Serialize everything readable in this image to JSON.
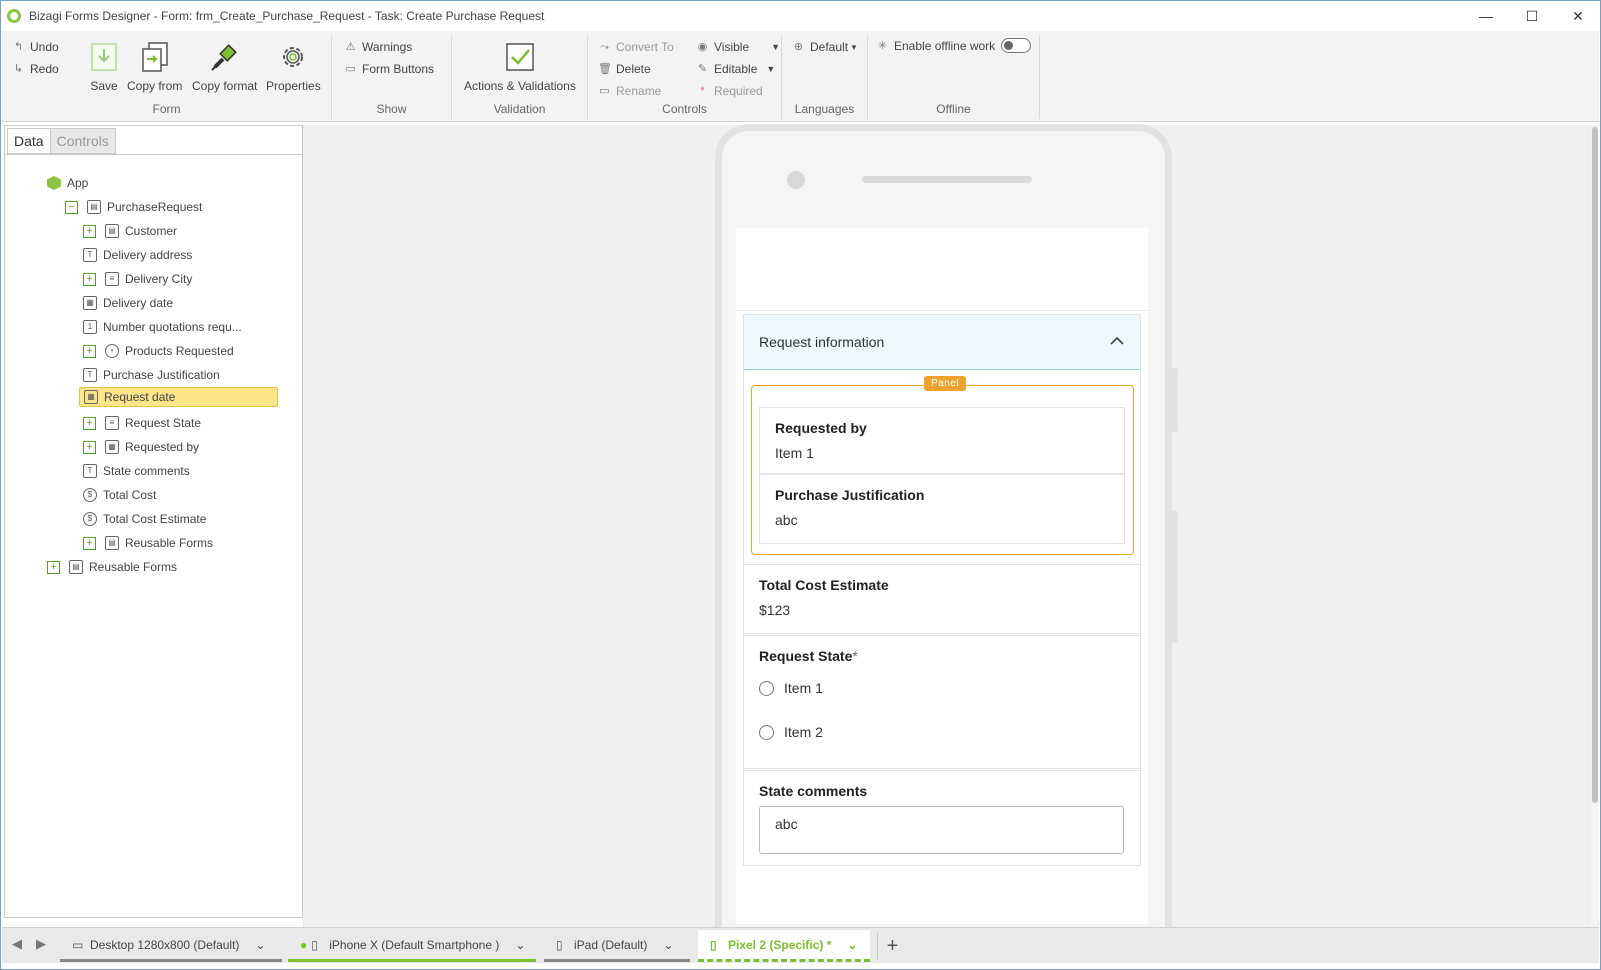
{
  "window": {
    "title": "Bizagi Forms Designer  - Form: frm_Create_Purchase_Request - Task:  Create Purchase Request",
    "minimize": "—",
    "maximize": "☐",
    "close": "✕"
  },
  "ribbon": {
    "undo": "Undo",
    "redo": "Redo",
    "save": "Save",
    "copy_from": "Copy from",
    "copy_format": "Copy format",
    "properties": "Properties",
    "group_form": "Form",
    "warnings": "Warnings",
    "form_buttons": "Form Buttons",
    "group_show": "Show",
    "actions_validations": "Actions & Validations",
    "group_validation": "Validation",
    "convert_to": "Convert To",
    "delete": "Delete",
    "rename": "Rename",
    "visible": "Visible",
    "editable": "Editable",
    "required": "Required",
    "group_controls": "Controls",
    "language": "Default",
    "group_languages": "Languages",
    "offline": "Enable offline work",
    "group_offline": "Offline"
  },
  "left_panel": {
    "tabs": [
      "Data",
      "Controls"
    ],
    "tree": [
      {
        "label": "App",
        "icon": "app-icon"
      },
      {
        "label": "PurchaseRequest",
        "icon": "entity-icon"
      },
      {
        "label": "Customer",
        "icon": "entity-icon"
      },
      {
        "label": "Delivery address",
        "icon": "text-icon"
      },
      {
        "label": "Delivery City",
        "icon": "list-icon"
      },
      {
        "label": "Delivery date",
        "icon": "date-icon"
      },
      {
        "label": "Number quotations requ...",
        "icon": "number-icon"
      },
      {
        "label": "Products Requested",
        "icon": "collection-icon"
      },
      {
        "label": "Purchase Justification",
        "icon": "text-icon"
      },
      {
        "label": "Request date",
        "icon": "date-icon"
      },
      {
        "label": "Request State",
        "icon": "list-icon"
      },
      {
        "label": "Requested by",
        "icon": "table-icon"
      },
      {
        "label": "State comments",
        "icon": "text-icon"
      },
      {
        "label": "Total Cost",
        "icon": "currency-icon"
      },
      {
        "label": "Total Cost Estimate",
        "icon": "currency-icon"
      },
      {
        "label": "Reusable Forms",
        "icon": "forms-icon"
      },
      {
        "label": "Reusable Forms",
        "icon": "forms-icon"
      }
    ]
  },
  "form": {
    "section_title": "Request information",
    "panel_badge": "Panel",
    "requested_by_label": "Requested by",
    "requested_by_value": "Item 1",
    "justification_label": "Purchase Justification",
    "justification_value": "abc",
    "total_cost_label": "Total Cost Estimate",
    "total_cost_value": "$123",
    "request_state_label": "Request State",
    "required_mark": "*",
    "request_state_options": [
      "Item 1",
      "Item 2"
    ],
    "state_comments_label": "State comments",
    "state_comments_value": "abc"
  },
  "devices": {
    "tabs": [
      "Desktop 1280x800 (Default)",
      "iPhone X (Default Smartphone )",
      "iPad (Default)",
      "Pixel 2 (Specific) *"
    ],
    "add": "+"
  },
  "colors": {
    "accent_green": "#8cc63f",
    "panel_orange": "#f0a22e",
    "selection": "#fde58a",
    "active_device_tab": "#7cbf2a"
  }
}
